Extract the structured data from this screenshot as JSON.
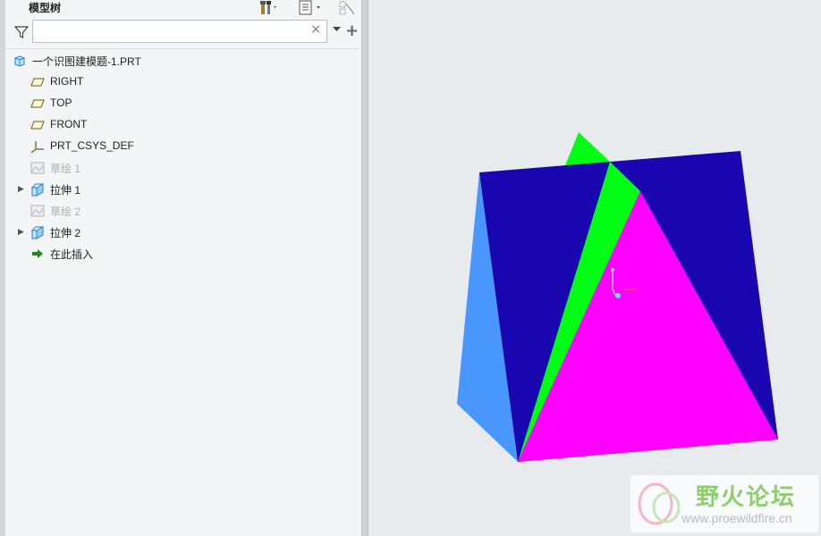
{
  "panel": {
    "title": "模型树",
    "search": {
      "value": "",
      "placeholder": ""
    },
    "clear_symbol": "×",
    "add_symbol": "+"
  },
  "tree": {
    "items": [
      {
        "label": "一个识图建模题-1.PRT",
        "icon": "part-icon",
        "expandable": false,
        "dim": false
      },
      {
        "label": "RIGHT",
        "icon": "datum-plane-icon",
        "expandable": false,
        "dim": false
      },
      {
        "label": "TOP",
        "icon": "datum-plane-icon",
        "expandable": false,
        "dim": false
      },
      {
        "label": "FRONT",
        "icon": "datum-plane-icon",
        "expandable": false,
        "dim": false
      },
      {
        "label": "PRT_CSYS_DEF",
        "icon": "coordinate-system-icon",
        "expandable": false,
        "dim": false
      },
      {
        "label": "草绘 1",
        "icon": "sketch-icon",
        "expandable": false,
        "dim": true
      },
      {
        "label": "拉伸 1",
        "icon": "extrude-icon",
        "expandable": true,
        "dim": false
      },
      {
        "label": "草绘 2",
        "icon": "sketch-icon",
        "expandable": false,
        "dim": true
      },
      {
        "label": "拉伸 2",
        "icon": "extrude-icon",
        "expandable": true,
        "dim": false
      },
      {
        "label": "在此插入",
        "icon": "insert-here-arrow-icon",
        "expandable": false,
        "dim": false
      }
    ]
  },
  "watermark": {
    "name": "野火论坛",
    "url": "www.proewildfire.cn"
  },
  "colors": {
    "face_dark_blue": "#1a06b0",
    "face_light_blue": "#4a96ff",
    "face_green": "#00ff14",
    "face_magenta": "#ff00ff",
    "viewport_bg": "#e8ebee"
  }
}
